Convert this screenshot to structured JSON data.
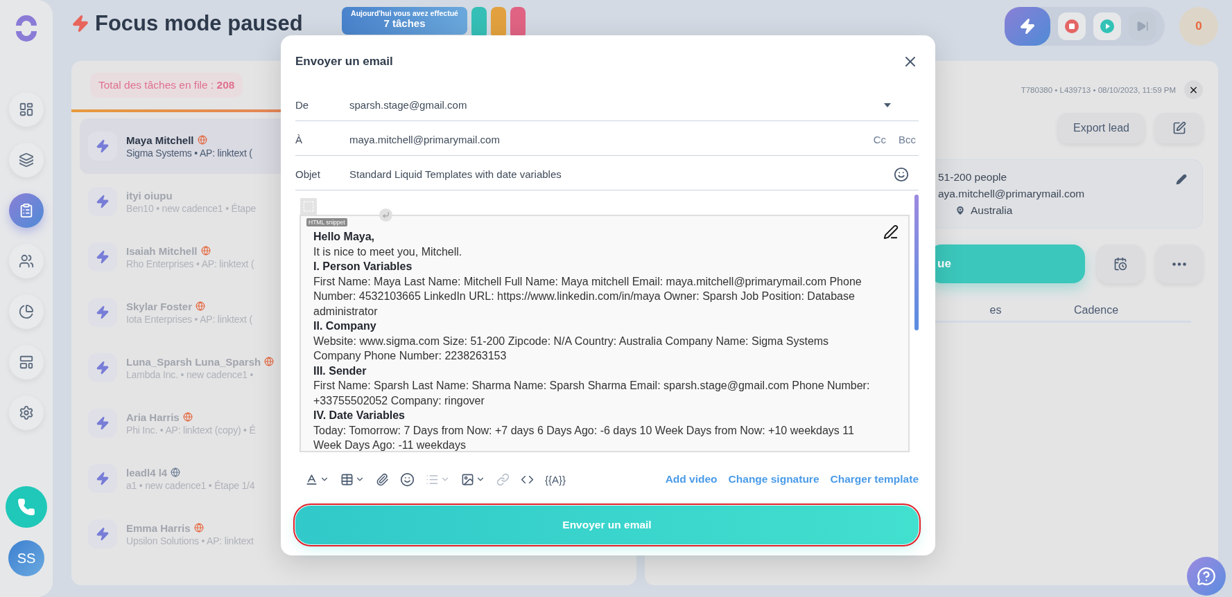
{
  "sidebar": {
    "items": [
      {
        "selected": false
      },
      {
        "selected": false
      },
      {
        "selected": true
      },
      {
        "selected": false
      },
      {
        "selected": false
      },
      {
        "selected": false
      },
      {
        "selected": false
      }
    ],
    "user_initials": "SS"
  },
  "header": {
    "title": "Focus mode paused",
    "stats": {
      "caption": "Aujourd'hui vous avez effectué",
      "value": "7 tâches"
    },
    "stat_pills": [
      {
        "color": "#35bfb6"
      },
      {
        "color": "#e2a13e"
      },
      {
        "color": "#e06384"
      }
    ],
    "controls": [
      {
        "kind": "focus"
      },
      {
        "kind": "stop"
      },
      {
        "kind": "play"
      },
      {
        "kind": "skip"
      }
    ],
    "counter": "0"
  },
  "queue": {
    "total": "Total des tâches en file : **208**"
  },
  "tasks": [
    {
      "name": "Maya Mitchell",
      "subtitle": "Sigma Systems • AP: linktext (",
      "selected": true,
      "color": "#e5683f"
    },
    {
      "name": "ityi oiupu",
      "subtitle": "Ben10 • new cadence1 • Étape",
      "selected": false
    },
    {
      "name": "Isaiah Mitchell",
      "subtitle": "Rho Enterprises • AP: linktext (",
      "selected": false,
      "color": "#e5683f"
    },
    {
      "name": "Skylar Foster",
      "subtitle": "Iota Enterprises • AP: linktext (",
      "selected": false,
      "color": "#e5683f"
    },
    {
      "name": "Luna_Sparsh Luna_Sparsh",
      "subtitle": "Lambda Inc. • new cadence1 •",
      "selected": false,
      "color": "#e5683f"
    },
    {
      "name": "Aria Harris",
      "subtitle": "Phi Inc. • AP: linktext (copy) • É",
      "selected": false,
      "color": "#e5683f"
    },
    {
      "name": "leadl4 l4",
      "subtitle": "a1 • new cadence1 • Étape 1/4",
      "selected": false,
      "color": "#6b7c93"
    },
    {
      "name": "Emma Harris",
      "subtitle": "Upsilon Solutions • AP: linktext",
      "selected": false,
      "color": "#e5683f"
    }
  ],
  "lead_panel": {
    "meta": "T780380 • L439713 • 08/10/2023, 11:59 PM",
    "export_button": "Export lead",
    "info": [
      {
        "kind": "size",
        "text": "51-200 people"
      },
      {
        "kind": "email",
        "text": "aya.mitchell@primarymail.com"
      },
      {
        "kind": "location",
        "text": "Australia"
      }
    ],
    "primary_button": "ue",
    "tabs": [
      {
        "label": "es"
      },
      {
        "label": "Cadence"
      }
    ]
  },
  "email_modal": {
    "title": "Envoyer un email",
    "fields": [
      {
        "kind": "select",
        "label": "De",
        "value": "sparsh.stage@gmail.com"
      },
      {
        "kind": "recipients",
        "label": "À",
        "value": "maya.mitchell@primarymail.com",
        "extras": [
          "Cc",
          "Bcc"
        ]
      },
      {
        "kind": "subject",
        "label": "Objet",
        "value": "Standard Liquid Templates with date variables"
      }
    ],
    "snippet_tag": "HTML snippet",
    "body": [
      {
        "kind": "heading",
        "text": "Hello Maya,"
      },
      {
        "kind": "text",
        "text": "It is nice to meet you, Mitchell."
      },
      {
        "kind": "heading",
        "text": "I. Person Variables"
      },
      {
        "kind": "text",
        "text": "First Name: Maya Last Name: Mitchell Full Name: Maya mitchell Email: maya.mitchell@primarymail.com Phone Number: 4532103665 LinkedIn URL: https://www.linkedin.com/in/maya Owner: Sparsh Job Position: Database administrator"
      },
      {
        "kind": "heading",
        "text": "II. Company"
      },
      {
        "kind": "text",
        "text": "Website: www.sigma.com Size: 51-200 Zipcode: N/A Country: Australia Company Name: Sigma Systems Company Phone Number: 2238263153"
      },
      {
        "kind": "heading",
        "text": "III. Sender"
      },
      {
        "kind": "text",
        "text": "First Name: Sparsh Last Name: Sharma Name: Sparsh Sharma Email: sparsh.stage@gmail.com Phone Number: +33755502052 Company: ringover"
      },
      {
        "kind": "heading",
        "text": "IV. Date Variables"
      },
      {
        "kind": "text",
        "text": "Today: Tomorrow: 7 Days from Now: +7 days 6 Days Ago: -6 days 10 Week Days from Now: +10 weekdays 11 Week Days Ago: -11 weekdays"
      }
    ],
    "tools": [
      {
        "kind": "text-color",
        "caret": true,
        "disabled": false
      },
      {
        "kind": "table",
        "caret": true,
        "disabled": false
      },
      {
        "kind": "attachment",
        "caret": false,
        "disabled": false
      },
      {
        "kind": "emoji",
        "caret": false,
        "disabled": false
      },
      {
        "kind": "list",
        "caret": true,
        "disabled": true
      },
      {
        "kind": "image",
        "caret": true,
        "disabled": false
      },
      {
        "kind": "link",
        "caret": false,
        "disabled": true
      },
      {
        "kind": "code",
        "caret": false,
        "disabled": false
      },
      {
        "kind": "variable",
        "label": "{{A}}",
        "caret": false,
        "disabled": false
      }
    ],
    "toolbar_links": [
      "Add video",
      "Change signature",
      "Charger template"
    ],
    "send_button": {
      "label": "Envoyer un email",
      "focused": true
    }
  }
}
